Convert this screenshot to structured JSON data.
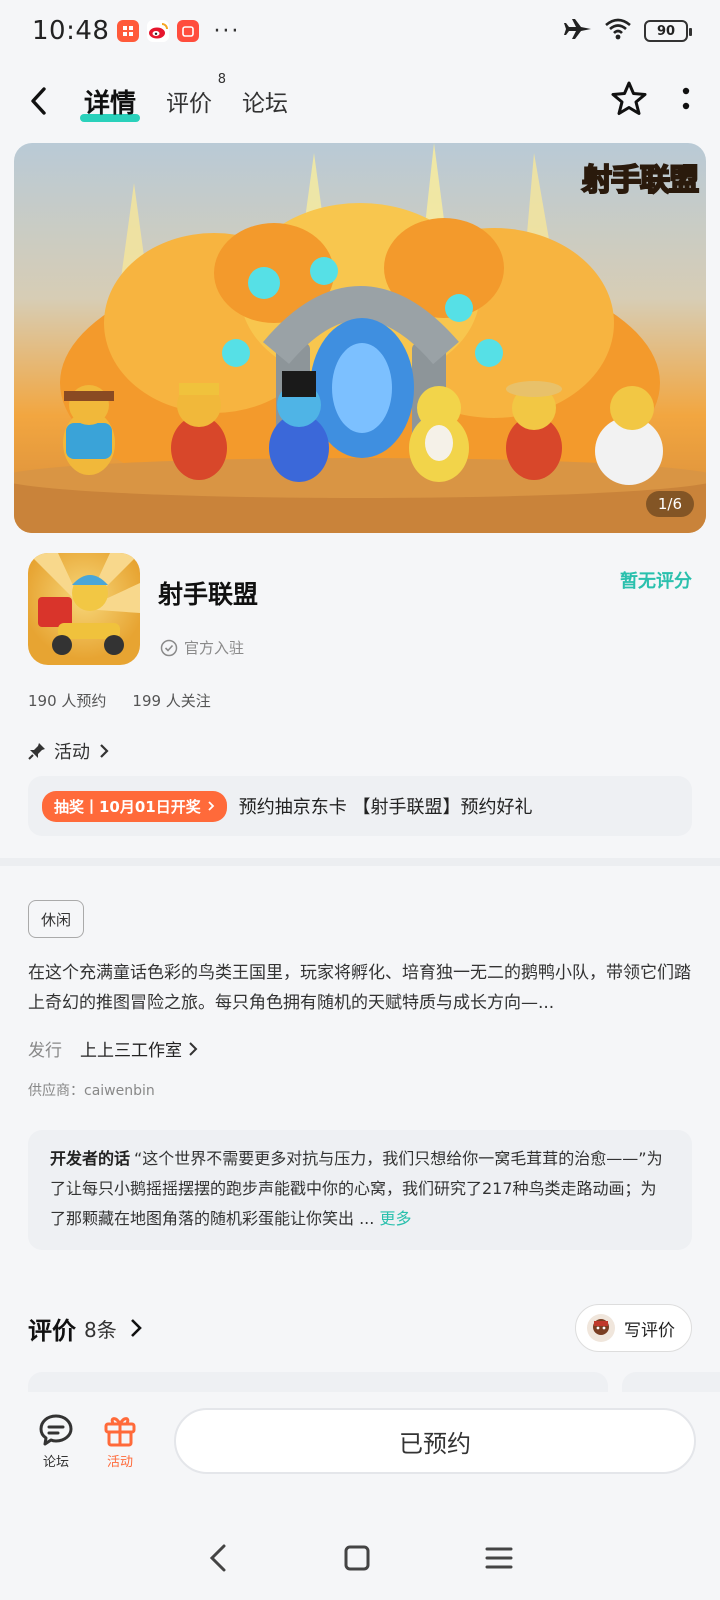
{
  "status_bar": {
    "time": "10:48",
    "dots": "···",
    "battery": "90"
  },
  "nav": {
    "tabs": [
      {
        "label": "详情",
        "active": true
      },
      {
        "label": "评价",
        "badge": "8"
      },
      {
        "label": "论坛"
      }
    ]
  },
  "banner": {
    "logo_text": "射手联盟",
    "counter": "1/6"
  },
  "app": {
    "name": "射手联盟",
    "official_label": "官方入驻",
    "rating_label": "暂无评分",
    "reservations": "190 人预约",
    "followers": "199 人关注"
  },
  "activity": {
    "label": "活动",
    "badge": "抽奖丨10月01日开奖",
    "text": "预约抽京东卡 【射手联盟】预约好礼"
  },
  "details": {
    "tag": "休闲",
    "description": "在这个充满童话色彩的鸟类王国里，玩家将孵化、培育独一无二的鹅鸭小队，带领它们踏上奇幻的推图冒险之旅。每只角色拥有随机的天赋特质与成长方向—...",
    "publisher_label": "发行",
    "publisher_name": "上上三工作室",
    "supplier": "供应商：caiwenbin"
  },
  "developer_words": {
    "lead": "开发者的话",
    "text": "“这个世界不需要更多对抗与压力，我们只想给你一窝毛茸茸的治愈——”为了让每只小鹅摇摇摆摆的跑步声能戳中你的心窝，我们研究了217种鸟类走路动画；为了那颗藏在地图角落的随机彩蛋能让你笑出 ...",
    "more": "更多"
  },
  "reviews": {
    "title": "评价",
    "count": "8条",
    "write_label": "写评价"
  },
  "bottom_bar": {
    "forum_label": "论坛",
    "activity_label": "活动",
    "reserved_label": "已预约"
  },
  "colors": {
    "accent": "#2ac0ad",
    "tab_underline": "#2ad1bb",
    "promo": "#ff6a3a"
  }
}
